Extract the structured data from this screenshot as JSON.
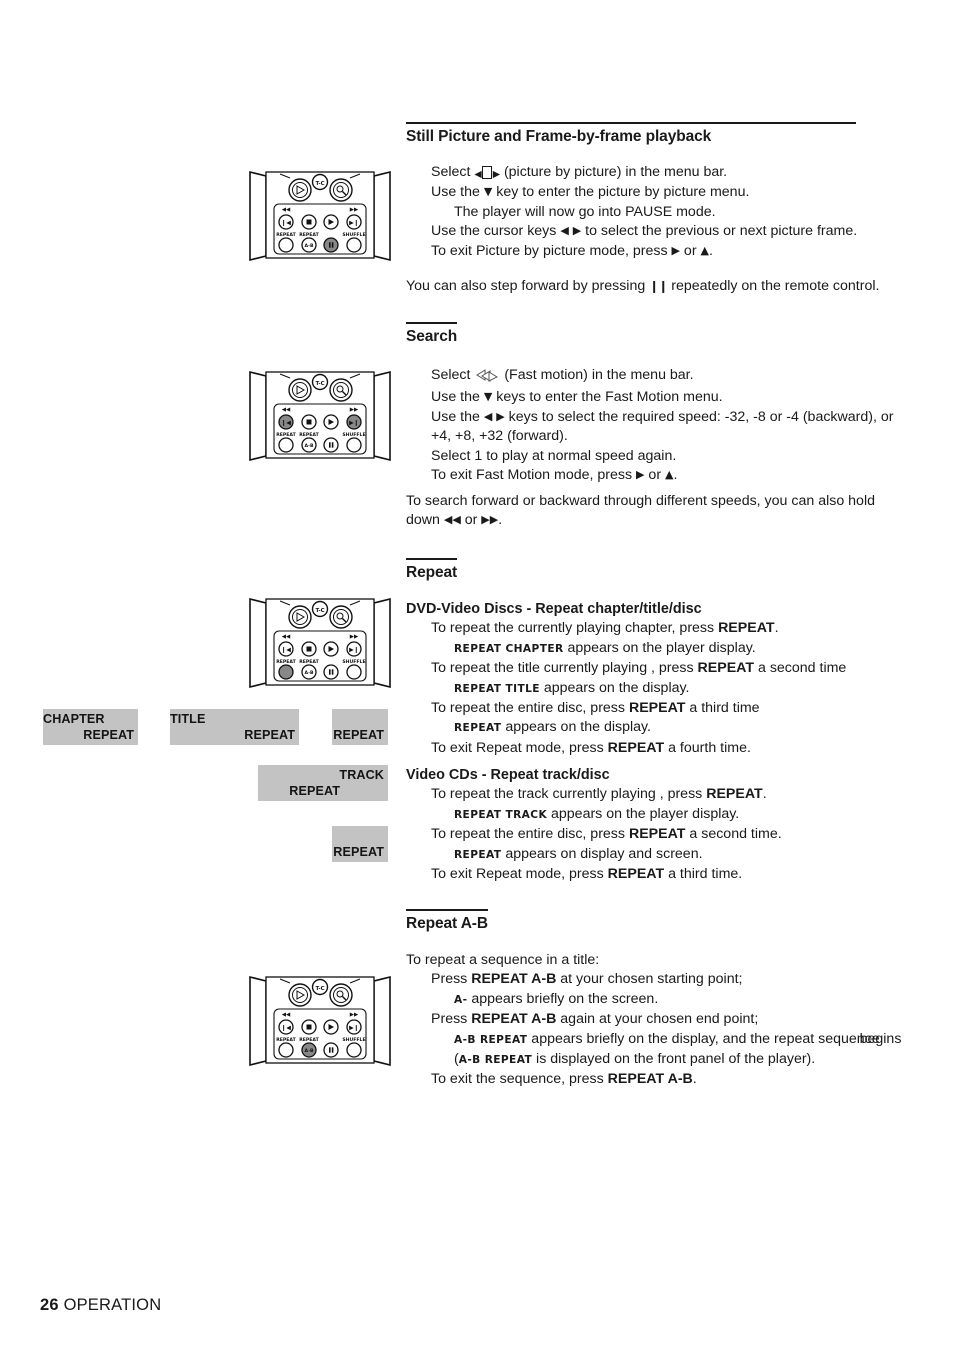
{
  "page": {
    "number": "26",
    "section_label": "OPERATION"
  },
  "sections": [
    {
      "id": "still-picture",
      "heading": "Still Picture and Frame-by-frame playback",
      "lines": [
        "Select ◀|▶ (picture by picture) in the menu bar.",
        "Use the ▼ key to enter the picture by picture menu.",
        "The player will now go into PAUSE mode.",
        "Use the cursor keys ◀ ▶ to select the previous or next picture frame.",
        "To exit Picture by picture mode, press ▶ or ▲."
      ],
      "note": "You can also step forward by pressing ❙❙ repeatedly on the remote control."
    },
    {
      "id": "search",
      "heading": "Search",
      "lines": [
        "Select ≫ (Fast motion) in the menu bar.",
        "Use the ▼ keys to enter the Fast Motion menu.",
        "Use the ◀ ▶ keys to select the required speed: -32, -8 or -4 (backward), or +4, +8, +32 (forward).",
        "Select 1 to play at normal speed again.",
        "To exit Fast Motion mode, press ▶ or ▲."
      ],
      "note": "To search forward or backward through different speeds, you can also hold down ◀◀ or ▶▶."
    },
    {
      "id": "repeat",
      "heading": "Repeat",
      "subsections": [
        {
          "title": "DVD-Video Discs - Repeat chapter/title/disc",
          "lines": [
            "To repeat the currently playing chapter, press REPEAT.",
            "REPEAT CHAPTER appears on the player display.",
            "To repeat the title currently playing , press REPEAT a second time",
            "REPEAT TITLE appears on the display.",
            "To repeat the entire disc, press REPEAT a third time",
            "REPEAT appears on the display.",
            "To exit Repeat mode, press REPEAT a fourth time."
          ]
        },
        {
          "title": "Video CDs - Repeat track/disc",
          "lines": [
            "To repeat the track currently playing , press REPEAT.",
            "REPEAT TRACK appears on the player display.",
            "To repeat the entire disc, press REPEAT a second time.",
            "REPEAT appears on display and screen.",
            "To exit Repeat mode, press REPEAT a third time."
          ]
        }
      ]
    },
    {
      "id": "repeat-ab",
      "heading": "Repeat A-B",
      "intro": "To repeat a sequence in a title:",
      "lines": [
        "Press REPEAT A-B at your chosen starting point;",
        "A- appears briefly on the screen.",
        "Press REPEAT A-B again at your chosen end point;",
        "A-B REPEAT appears briefly on the display, and the repeat sequence begins (A-B REPEAT is displayed on the front panel of the player).",
        "To exit the sequence, press REPEAT A-B."
      ]
    }
  ],
  "displays": [
    {
      "id": "chapter-repeat",
      "top_label": "CHAPTER",
      "bottom_label": "REPEAT"
    },
    {
      "id": "title-repeat",
      "top_label": "TITLE",
      "bottom_label": "REPEAT"
    },
    {
      "id": "disc-repeat",
      "top_label": "",
      "bottom_label": "REPEAT"
    },
    {
      "id": "track-repeat",
      "top_label": "TRACK",
      "bottom_label": "REPEAT"
    },
    {
      "id": "vcd-disc-repeat",
      "top_label": "",
      "bottom_label": "REPEAT"
    }
  ],
  "remote": {
    "jog_label": "T-C",
    "row_top_left_glyph": "◀◀",
    "row_top_right_glyph": "▶▶",
    "button_labels": {
      "repeat": "REPEAT",
      "repeat_ab": "REPEAT",
      "ab": "A-B",
      "shuffle": "SHUFFLE"
    },
    "highlights": {
      "still_picture": "pause",
      "search": "prev-next",
      "repeat": "repeat",
      "repeat_ab": "ab"
    }
  },
  "colors": {
    "text": "#1a1a1a",
    "display_bg": "#c3c3c3",
    "button_highlight": "#888888",
    "page_bg": "#ffffff"
  }
}
